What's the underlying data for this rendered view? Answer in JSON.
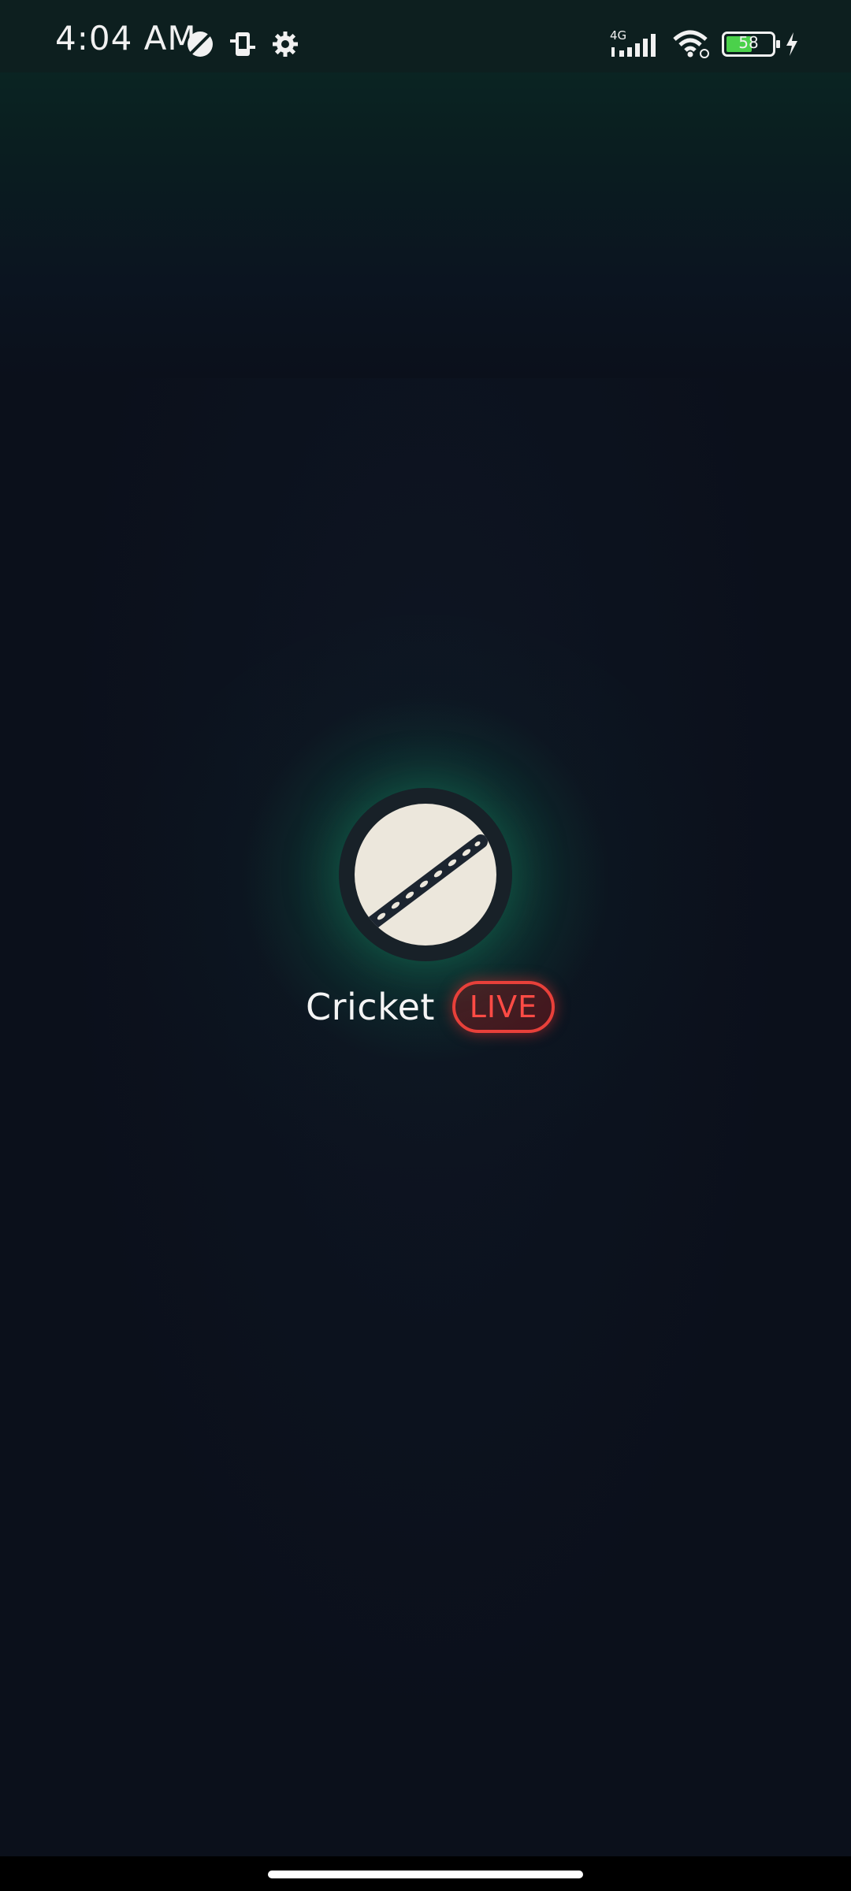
{
  "status_bar": {
    "time": "4:04 AM",
    "network_type": "4G",
    "battery_level": "58",
    "left_icons": [
      "dnd-moon-icon",
      "phone-sync-icon",
      "settings-gear-icon"
    ],
    "right_icons": [
      "signal-bars-icon",
      "wifi-icon",
      "battery-icon",
      "charging-bolt-icon"
    ]
  },
  "app": {
    "title": "Cricket",
    "badge": "LIVE"
  },
  "colors": {
    "background": "#0b101b",
    "glow": "#14a06e",
    "live_red": "#e8403a",
    "ball_cream": "#ece7dc"
  }
}
